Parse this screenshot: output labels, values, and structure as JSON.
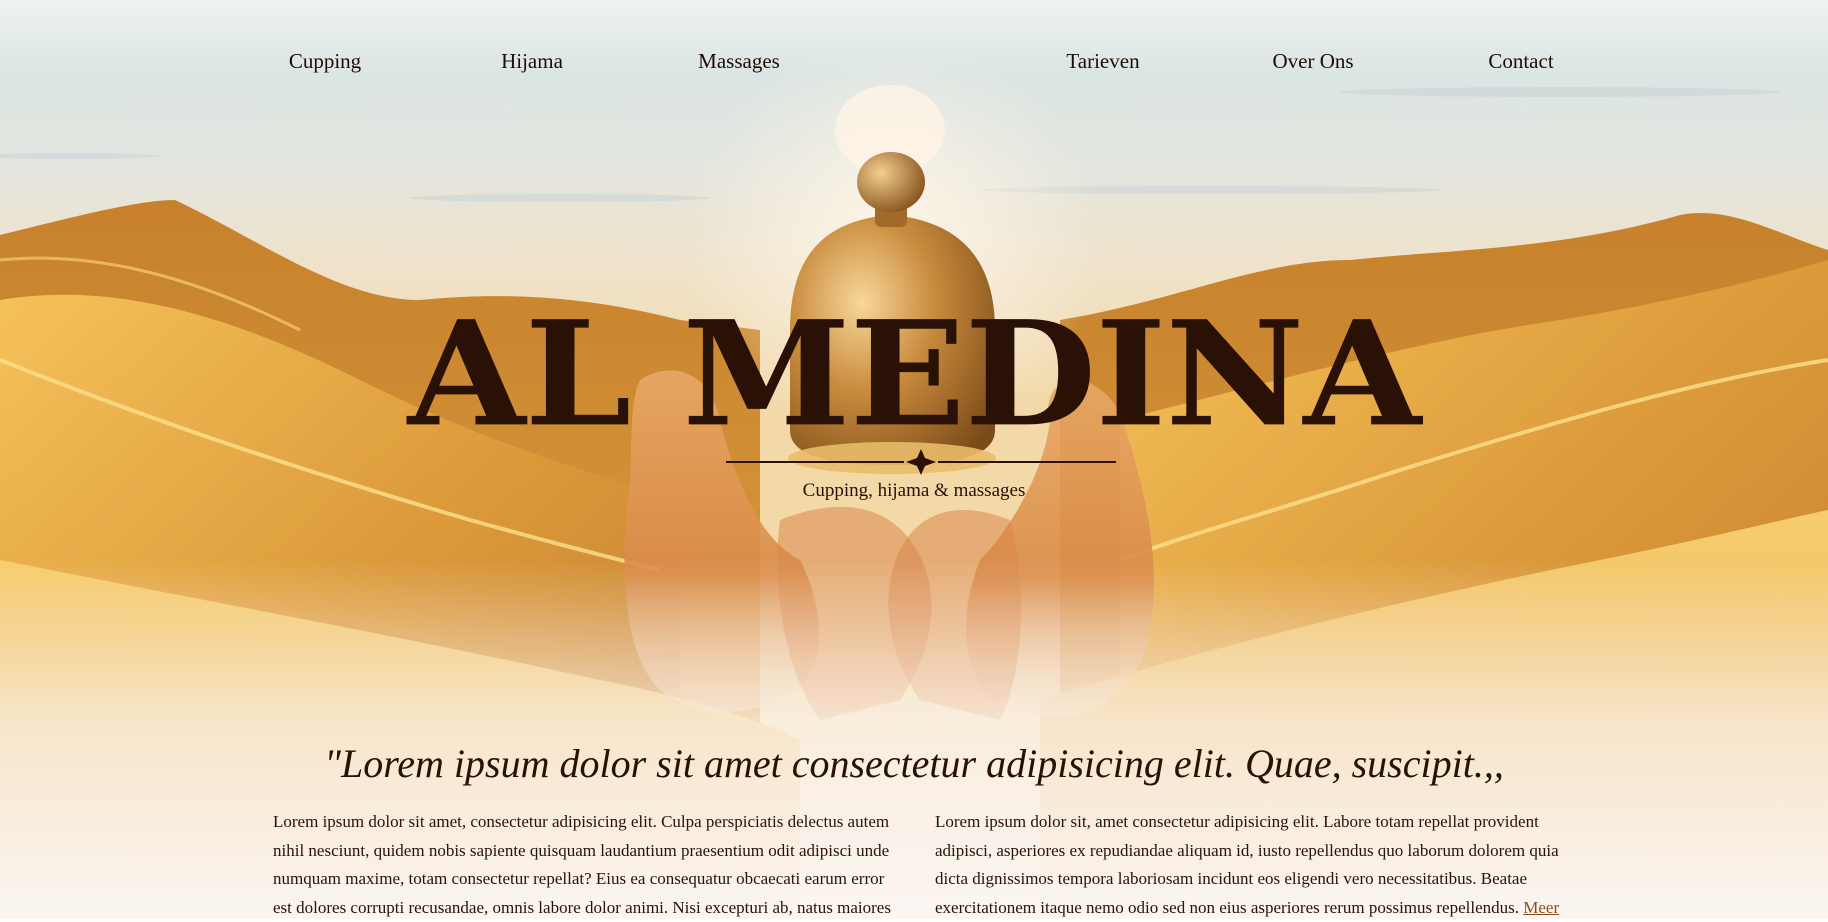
{
  "nav": {
    "items": [
      "Cupping",
      "Hijama",
      "Massages",
      "Tarieven",
      "Over Ons",
      "Contact"
    ]
  },
  "hero": {
    "title": "AL MEDINA",
    "subtitle": "Cupping, hijama & massages",
    "image": "hands-holding-golden-cup-over-desert-dunes"
  },
  "quote": "\"Lorem ipsum dolor sit amet consectetur adipisicing elit. Quae, suscipit.,,",
  "columns": {
    "left": "Lorem ipsum dolor sit amet, consectetur adipisicing elit. Culpa perspiciatis delectus autem nihil nesciunt, quidem nobis sapiente quisquam laudantium praesentium odit adipisci unde numquam maxime, totam consectetur repellat? Eius ea consequatur obcaecati earum error est dolores corrupti recusandae, omnis labore dolor animi. Nisi excepturi ab, natus maiores",
    "right": "Lorem ipsum dolor sit, amet consectetur adipisicing elit. Labore totam repellat provident adipisci, asperiores ex repudiandae aliquam id, iusto repellendus quo laborum dolorem quia dicta dignissimos tempora laboriosam incidunt eos eligendi vero necessitatibus. Beatae exercitationem itaque nemo odio sed non eius asperiores rerum possimus repellendus.",
    "right_link": "Meer"
  },
  "colors": {
    "text": "#2a1106",
    "link": "#8a4e1c",
    "sand": "#d9952f",
    "sky": "#dfe6e4"
  }
}
